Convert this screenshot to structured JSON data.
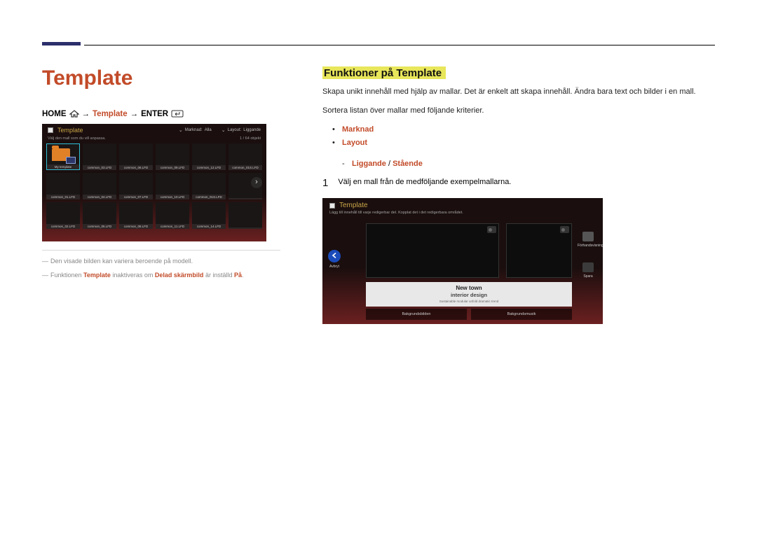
{
  "page": {
    "title": "Template"
  },
  "breadcrumb": {
    "home": "HOME",
    "arrow": "→",
    "item": "Template",
    "enter": "ENTER"
  },
  "screenshot1": {
    "title": "Template",
    "dropdown1_label": "Marknad:",
    "dropdown1_value": "Alla",
    "dropdown2_label": "Layout:",
    "dropdown2_value": "Liggande",
    "subtitle": "Välj den mall som du vill anpassa.",
    "counter": "1 / 64 objekt",
    "cells": [
      "My template",
      "common_03.LFD",
      "common_06.LFD",
      "common_09.LFD",
      "common_12.LFD",
      "common_01S.LFD",
      "common_01.LFD",
      "common_04.LFD",
      "common_07.LFD",
      "common_10.LFD",
      "common_01S.LFD",
      "",
      "common_02.LFD",
      "common_05.LFD",
      "common_08.LFD",
      "common_11.LFD",
      "common_14.LFD",
      ""
    ]
  },
  "footnotes": {
    "a": "Den visade bilden kan variera beroende på modell.",
    "b_pre": "Funktionen ",
    "b_o1": "Template",
    "b_mid": " inaktiveras om ",
    "b_o2": "Delad skärmbild",
    "b_mid2": " är inställd ",
    "b_o3": "På",
    "b_end": "."
  },
  "right": {
    "heading": "Funktioner på Template",
    "p1": "Skapa unikt innehåll med hjälp av mallar. Det är enkelt att skapa innehåll. Ändra bara text och bilder i en mall.",
    "p2": "Sortera listan över mallar med följande kriterier.",
    "bullet1": "Marknad",
    "bullet2": "Layout",
    "sub_a": "Liggande",
    "sub_sep": " / ",
    "sub_b": "Stående",
    "step1_num": "1",
    "step1_text": "Välj en mall från de medföljande exempelmallarna."
  },
  "screenshot2": {
    "title": "Template",
    "subtitle": "Lägg till innehåll till varje redigerbar del. Kopplat det i det redigerbara området.",
    "back": "Avbryt",
    "right1": "Förhandsvisning",
    "right2": "Spara",
    "txt1": "New town",
    "txt2": "interior design",
    "txt3": "Sustainable modular unfold dramatic trend",
    "bb1": "Bakgrundsbilden",
    "bb2": "Bakgrundsmusik"
  }
}
